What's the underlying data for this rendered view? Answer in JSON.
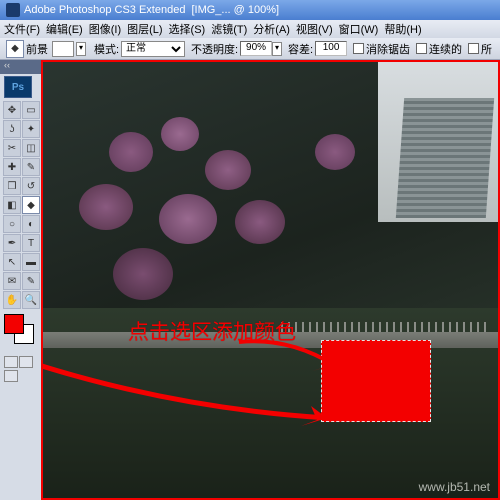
{
  "titlebar": {
    "app": "Adobe Photoshop CS3 Extended",
    "doc": "[IMG_... @ 100%]"
  },
  "menu": {
    "file": "文件(F)",
    "edit": "编辑(E)",
    "image": "图像(I)",
    "layer": "图层(L)",
    "select": "选择(S)",
    "filter": "滤镜(T)",
    "analysis": "分析(A)",
    "view": "视图(V)",
    "window": "窗口(W)",
    "help": "帮助(H)"
  },
  "options": {
    "fg_label": "前景",
    "arrow": "▾",
    "mode_label": "模式:",
    "mode_value": "正常",
    "opacity_label": "不透明度:",
    "opacity_value": "90%",
    "tolerance_label": "容差:",
    "tolerance_value": "100",
    "antialias": "消除锯齿",
    "contiguous": "连续的",
    "all_layers": "所"
  },
  "toolbox": {
    "ps": "Ps"
  },
  "swatches": {
    "fg": "#f30000",
    "bg": "#ffffff"
  },
  "annotation": {
    "text": "点击选区添加颜色"
  },
  "watermark": {
    "text": "www.jb51.net"
  }
}
